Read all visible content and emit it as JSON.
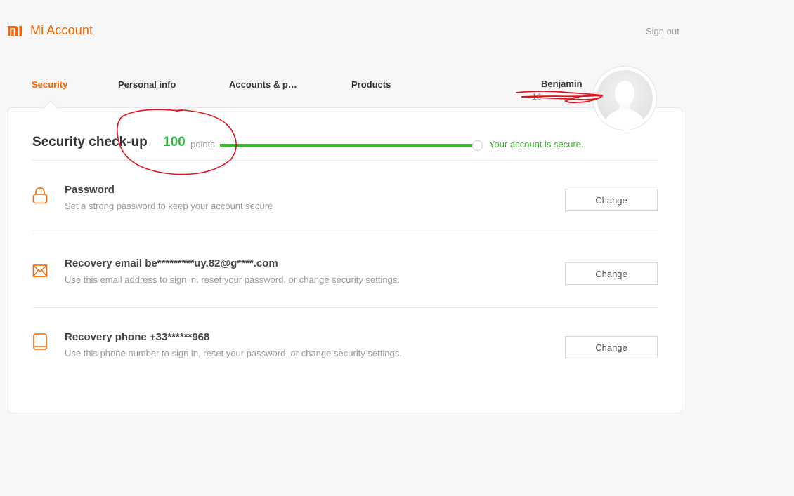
{
  "header": {
    "logo_icon": "mi-logo-icon",
    "brand": "Mi Account",
    "signout": "Sign out"
  },
  "tabs": [
    {
      "label": "Security",
      "active": true
    },
    {
      "label": "Personal info",
      "active": false
    },
    {
      "label": "Accounts & p…",
      "active": false
    },
    {
      "label": "Products",
      "active": false
    }
  ],
  "user": {
    "name": "Benjamin",
    "id_fragment": "16",
    "avatar_icon": "default-avatar-icon"
  },
  "checkup": {
    "title": "Security check-up",
    "score": "100",
    "score_unit": "points",
    "progress_percent": 100,
    "status": "Your account is secure."
  },
  "items": [
    {
      "icon": "lock-icon",
      "title": "Password",
      "description": "Set a strong password to keep your account secure",
      "button": "Change"
    },
    {
      "icon": "envelope-icon",
      "title": "Recovery email be*********uy.82@g****.com",
      "description": "Use this email address to sign in, reset your password, or change security settings.",
      "button": "Change"
    },
    {
      "icon": "phone-icon",
      "title": "Recovery phone +33******968",
      "description": "Use this phone number to sign in, reset your password, or change security settings.",
      "button": "Change"
    }
  ],
  "colors": {
    "brand": "#f56600",
    "success": "#2ebd1e",
    "annotation": "#e0141e"
  }
}
